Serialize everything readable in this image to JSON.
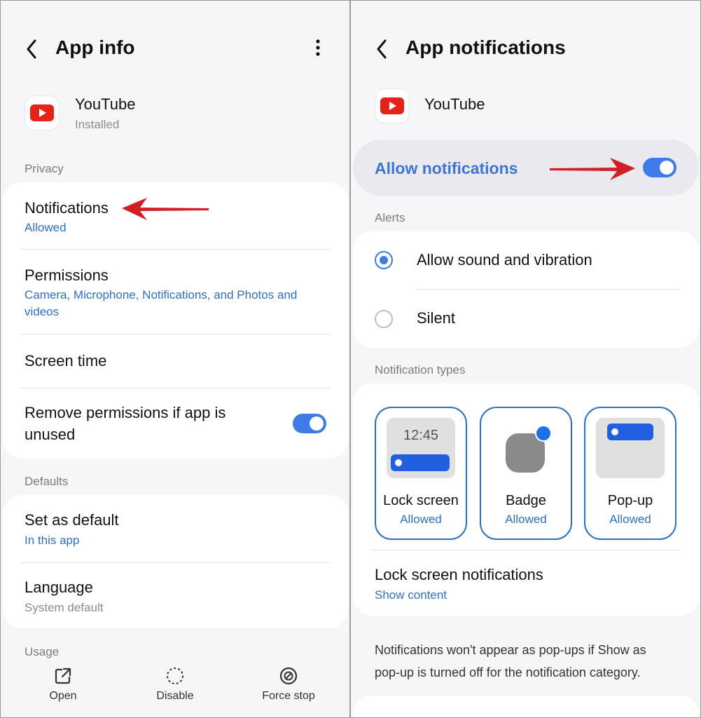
{
  "left": {
    "header": {
      "title": "App info"
    },
    "app": {
      "name": "YouTube",
      "status": "Installed"
    },
    "privacy_label": "Privacy",
    "privacy": {
      "notifications": {
        "title": "Notifications",
        "sub": "Allowed"
      },
      "permissions": {
        "title": "Permissions",
        "sub_line1": "Camera, Microphone, Notifications, and Photos and",
        "sub_line2": "videos"
      },
      "screen_time": {
        "title": "Screen time"
      },
      "remove_perm": {
        "line1": "Remove permissions if app is",
        "line2": "unused",
        "enabled": true
      }
    },
    "defaults_label": "Defaults",
    "defaults": {
      "set_default": {
        "title": "Set as default",
        "sub": "In this app"
      },
      "language": {
        "title": "Language",
        "sub": "System default"
      }
    },
    "usage_label": "Usage",
    "bottom": {
      "open": "Open",
      "disable": "Disable",
      "force_stop": "Force stop"
    }
  },
  "right": {
    "header": {
      "title": "App notifications"
    },
    "app": {
      "name": "YouTube"
    },
    "allow": {
      "label": "Allow notifications",
      "enabled": true
    },
    "alerts_label": "Alerts",
    "alerts": {
      "sound": "Allow sound and vibration",
      "silent": "Silent",
      "selected": "sound"
    },
    "types_label": "Notification types",
    "types": {
      "lock": {
        "label": "Lock screen",
        "sub": "Allowed",
        "time": "12:45"
      },
      "badge": {
        "label": "Badge",
        "sub": "Allowed"
      },
      "popup": {
        "label": "Pop-up",
        "sub": "Allowed"
      }
    },
    "lock_notifs": {
      "title": "Lock screen notifications",
      "sub": "Show content"
    },
    "footnote": {
      "line1": "Notifications won't appear as pop-ups if Show as",
      "line2": "pop-up is turned off for the notification category."
    }
  },
  "colors": {
    "accent": "#3e7be6",
    "link": "#2f6fc2",
    "arrow": "#d21f26",
    "youtube_red": "#e62117"
  }
}
